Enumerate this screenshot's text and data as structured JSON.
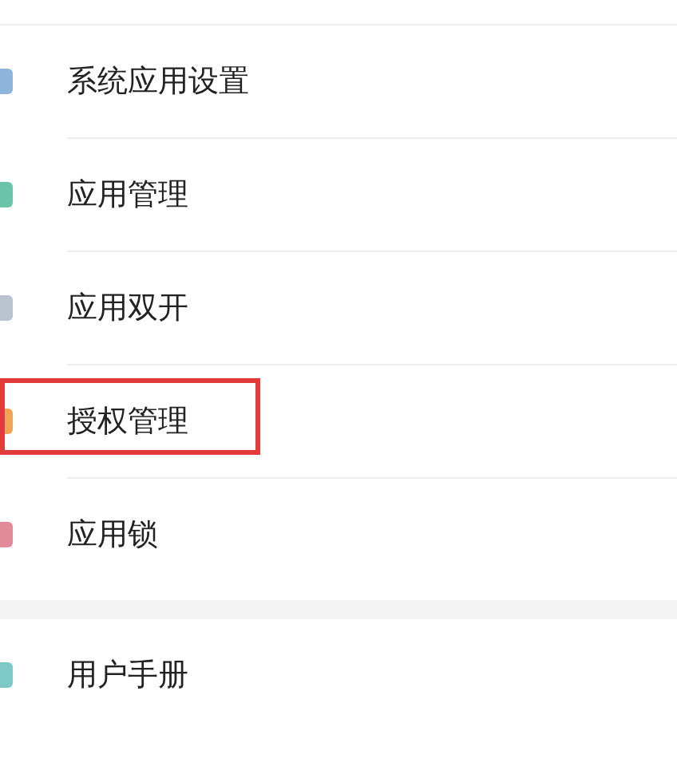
{
  "sections": [
    {
      "items": [
        {
          "label": "系统应用设置",
          "highlighted": false,
          "color": "#8fb4d9"
        },
        {
          "label": "应用管理",
          "highlighted": false,
          "color": "#6cc4a8"
        },
        {
          "label": "应用双开",
          "highlighted": false,
          "color": "#b9c3cf"
        },
        {
          "label": "授权管理",
          "highlighted": true,
          "color": "#f2a35a"
        },
        {
          "label": "应用锁",
          "highlighted": false,
          "color": "#e08a9a"
        }
      ]
    },
    {
      "items": [
        {
          "label": "用户手册",
          "highlighted": false,
          "color": "#7fc8c8"
        }
      ]
    }
  ]
}
